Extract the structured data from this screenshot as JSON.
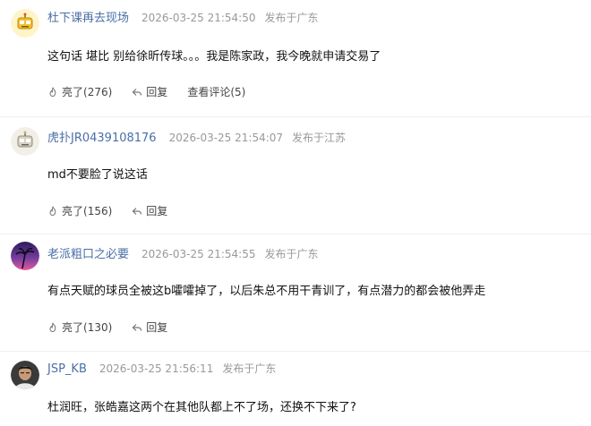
{
  "comments": [
    {
      "username": "杜下课再去现场",
      "time": "2026-03-25 21:54:50",
      "location": "发布于广东",
      "text": "这句话 堪比 别给徐昕传球。。。我是陈家政，我今晚就申请交易了",
      "like_label": "亮了",
      "like_count": "(276)",
      "reply_label": "回复",
      "view_replies": "查看评论(5)",
      "avatar_icon": "yellow-robot-avatar"
    },
    {
      "username": "虎扑JR0439108176",
      "time": "2026-03-25 21:54:07",
      "location": "发布于江苏",
      "text": "md不要脸了说这话",
      "like_label": "亮了",
      "like_count": "(156)",
      "reply_label": "回复",
      "avatar_icon": "gray-robot-avatar"
    },
    {
      "username": "老派粗口之必要",
      "time": "2026-03-25 21:54:55",
      "location": "发布于广东",
      "text": "有点天赋的球员全被这b嚯嚯掉了，以后朱总不用干青训了，有点潜力的都会被他弄走",
      "like_label": "亮了",
      "like_count": "(130)",
      "reply_label": "回复",
      "avatar_icon": "palm-sunset-avatar"
    },
    {
      "username": "JSP_KB",
      "time": "2026-03-25 21:56:11",
      "location": "发布于广东",
      "text": "杜润旺，张皓嘉这两个在其他队都上不了场，还换不下来了?",
      "avatar_icon": "person-photo-avatar"
    }
  ]
}
